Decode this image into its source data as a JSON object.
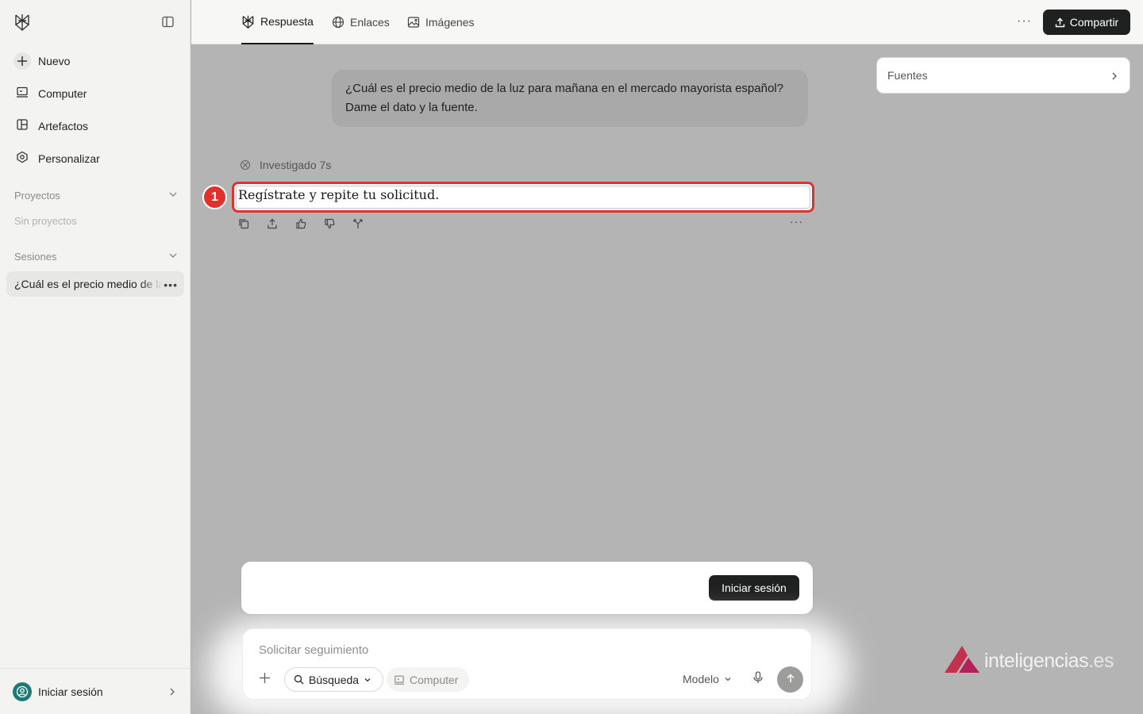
{
  "sidebar": {
    "nav": [
      {
        "label": "Nuevo",
        "icon": "plus-icon"
      },
      {
        "label": "Computer",
        "icon": "computer-icon"
      },
      {
        "label": "Artefactos",
        "icon": "artifacts-icon"
      },
      {
        "label": "Personalizar",
        "icon": "customize-icon"
      }
    ],
    "projects": {
      "label": "Proyectos",
      "empty": "Sin proyectos"
    },
    "sessions": {
      "label": "Sesiones",
      "items": [
        {
          "title": "¿Cuál es el precio medio de la luz para mañana"
        }
      ]
    },
    "signin_label": "Iniciar sesión"
  },
  "topbar": {
    "tabs": [
      {
        "label": "Respuesta",
        "active": true
      },
      {
        "label": "Enlaces",
        "active": false
      },
      {
        "label": "Imágenes",
        "active": false
      }
    ],
    "share_label": "Compartir"
  },
  "thread": {
    "question": "¿Cuál es el precio medio de la luz para mañana en el mercado mayorista español? Dame el dato y la fuente.",
    "researched": "Investigado 7s",
    "answer": "Regístrate y repite tu solicitud.",
    "annotation_number": "1"
  },
  "sources": {
    "label": "Fuentes"
  },
  "login_card": {
    "button_label": "Iniciar sesión"
  },
  "composer": {
    "placeholder": "Solicitar seguimiento",
    "search_chip": "Búsqueda",
    "computer_chip": "Computer",
    "model_label": "Modelo"
  },
  "watermark": {
    "brand": "inteligencias",
    "tld": ".es"
  },
  "colors": {
    "accent_red": "#e2312c",
    "dark_button": "#1f2120",
    "overlay": "#b4b4b4"
  }
}
